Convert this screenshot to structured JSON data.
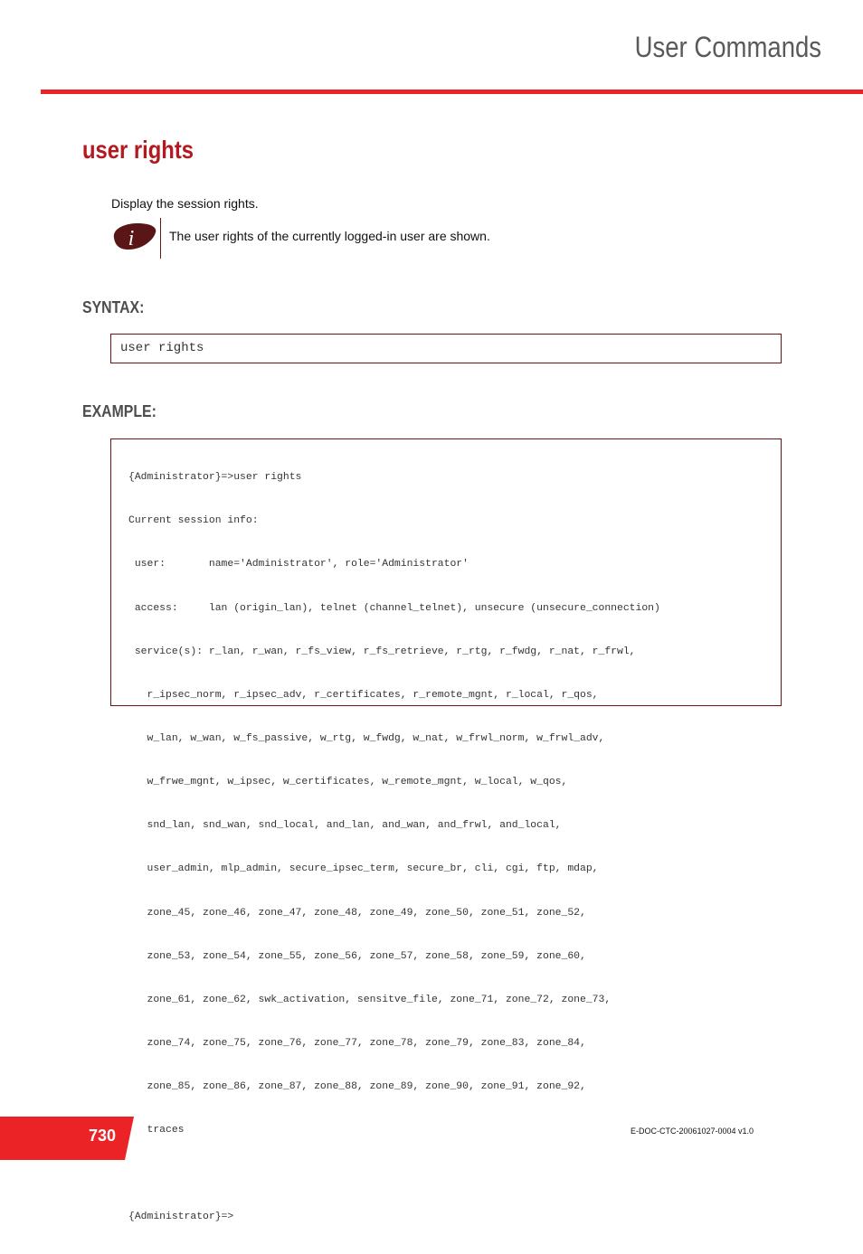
{
  "header": {
    "title": "User Commands",
    "accent_color": "#ec2326"
  },
  "page": {
    "title": "user rights",
    "title_color": "#b3191f",
    "description": "Display the session rights.",
    "note": {
      "icon": "info-icon",
      "text": "The user rights of the currently logged-in user are shown."
    }
  },
  "syntax": {
    "label": "SYNTAX:",
    "code": "user rights"
  },
  "example": {
    "label": "EXAMPLE:",
    "lines": [
      "{Administrator}=>user rights",
      "Current session info:",
      " user:       name='Administrator', role='Administrator'",
      " access:     lan (origin_lan), telnet (channel_telnet), unsecure (unsecure_connection)",
      " service(s): r_lan, r_wan, r_fs_view, r_fs_retrieve, r_rtg, r_fwdg, r_nat, r_frwl,",
      "   r_ipsec_norm, r_ipsec_adv, r_certificates, r_remote_mgnt, r_local, r_qos,",
      "   w_lan, w_wan, w_fs_passive, w_rtg, w_fwdg, w_nat, w_frwl_norm, w_frwl_adv,",
      "   w_frwe_mgnt, w_ipsec, w_certificates, w_remote_mgnt, w_local, w_qos,",
      "   snd_lan, snd_wan, snd_local, and_lan, and_wan, and_frwl, and_local,",
      "   user_admin, mlp_admin, secure_ipsec_term, secure_br, cli, cgi, ftp, mdap,",
      "   zone_45, zone_46, zone_47, zone_48, zone_49, zone_50, zone_51, zone_52,",
      "   zone_53, zone_54, zone_55, zone_56, zone_57, zone_58, zone_59, zone_60,",
      "   zone_61, zone_62, swk_activation, sensitve_file, zone_71, zone_72, zone_73,",
      "   zone_74, zone_75, zone_76, zone_77, zone_78, zone_79, zone_83, zone_84,",
      "   zone_85, zone_86, zone_87, zone_88, zone_89, zone_90, zone_91, zone_92,",
      "   traces",
      "",
      "{Administrator}=>"
    ]
  },
  "footer": {
    "page_number": "730",
    "doc_id": "E-DOC-CTC-20061027-0004 v1.0"
  }
}
